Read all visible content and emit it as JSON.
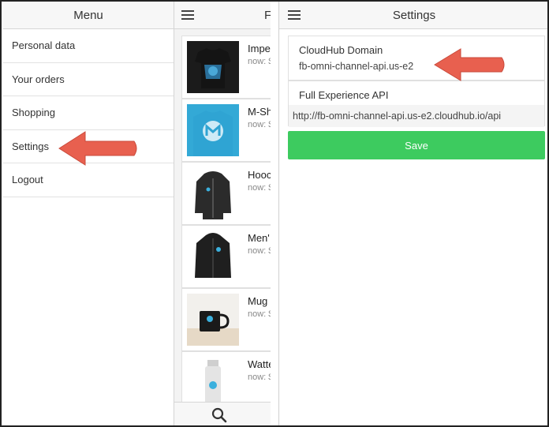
{
  "menu": {
    "title": "Menu",
    "items": [
      {
        "label": "Personal data"
      },
      {
        "label": "Your orders"
      },
      {
        "label": "Shopping"
      },
      {
        "label": "Settings"
      },
      {
        "label": "Logout"
      }
    ]
  },
  "shop": {
    "title": "F",
    "products": [
      {
        "name": "Impe",
        "meta": "now: $"
      },
      {
        "name": "M-Sh",
        "meta": "now: $"
      },
      {
        "name": "Hooc",
        "meta": "now: $"
      },
      {
        "name": "Men'",
        "meta": "now: $"
      },
      {
        "name": "Mug",
        "meta": "now: $"
      },
      {
        "name": "Watte",
        "meta": "now: $"
      }
    ]
  },
  "settings": {
    "title": "Settings",
    "domain_label": "CloudHub Domain",
    "domain_value": "fb-omni-channel-api.us-e2",
    "api_label": "Full Experience API",
    "api_value": "http://fb-omni-channel-api.us-e2.cloudhub.io/api",
    "save_label": "Save"
  },
  "colors": {
    "save_green": "#3dcb5f",
    "arrow_red": "#e8604f"
  }
}
